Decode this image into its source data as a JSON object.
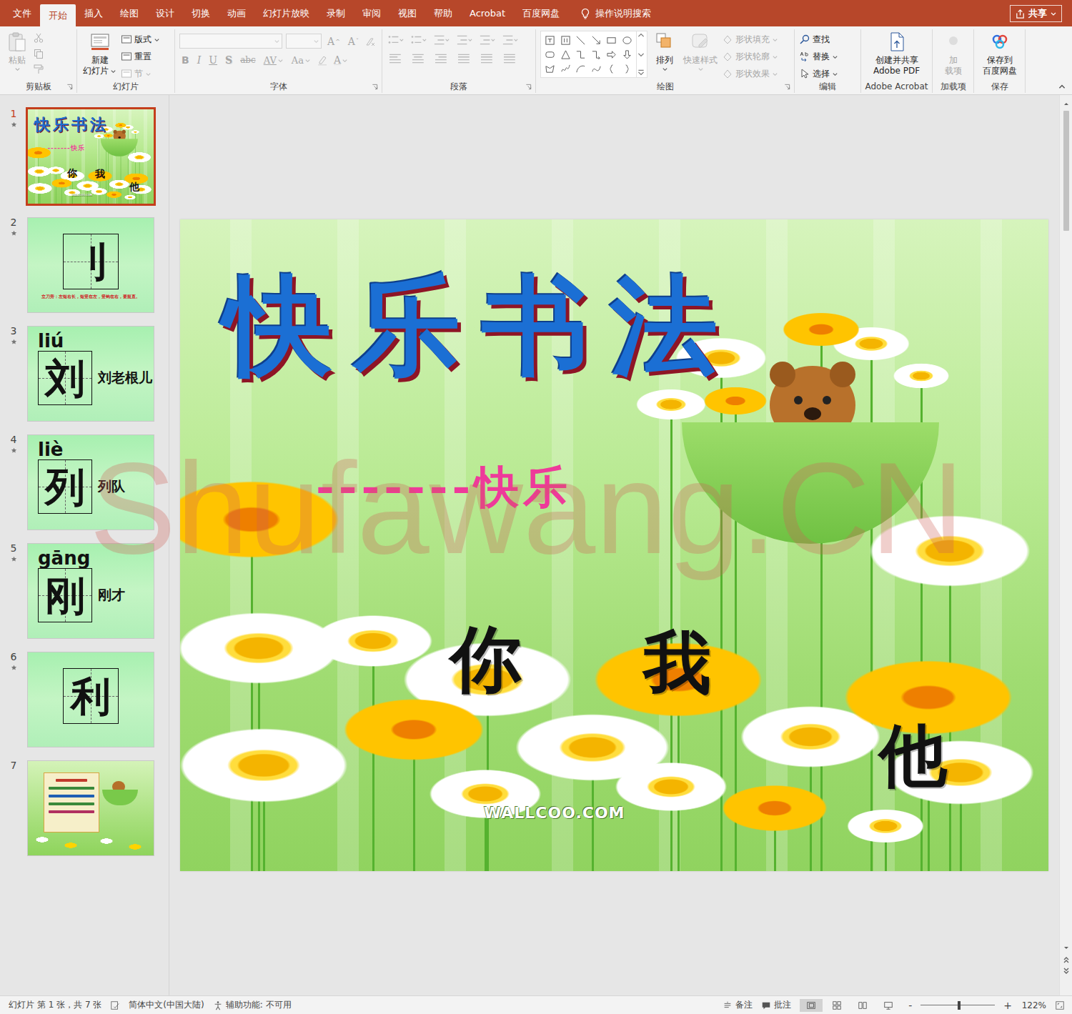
{
  "tabs": [
    {
      "label": "文件",
      "selected": false
    },
    {
      "label": "开始",
      "selected": true
    },
    {
      "label": "插入",
      "selected": false
    },
    {
      "label": "绘图",
      "selected": false
    },
    {
      "label": "设计",
      "selected": false
    },
    {
      "label": "切换",
      "selected": false
    },
    {
      "label": "动画",
      "selected": false
    },
    {
      "label": "幻灯片放映",
      "selected": false
    },
    {
      "label": "录制",
      "selected": false
    },
    {
      "label": "审阅",
      "selected": false
    },
    {
      "label": "视图",
      "selected": false
    },
    {
      "label": "帮助",
      "selected": false
    },
    {
      "label": "Acrobat",
      "selected": false
    },
    {
      "label": "百度网盘",
      "selected": false
    }
  ],
  "search": {
    "label": "操作说明搜索"
  },
  "share": {
    "label": "共享"
  },
  "ribbon": {
    "clipboard": {
      "label": "剪贴板",
      "paste": {
        "label": "粘贴",
        "disabled": true
      }
    },
    "slides": {
      "label": "幻灯片",
      "new_slide": {
        "line1": "新建",
        "line2": "幻灯片"
      },
      "items": [
        {
          "label": "版式",
          "disabled": false,
          "dropdown": true
        },
        {
          "label": "重置",
          "disabled": false,
          "dropdown": false
        },
        {
          "label": "节",
          "disabled": true,
          "dropdown": true
        }
      ]
    },
    "font": {
      "label": "字体",
      "font_name": "",
      "font_size": "",
      "grow": {
        "label": "A",
        "disabled": true
      },
      "shrink": {
        "label": "A",
        "disabled": true
      },
      "format_buttons": [
        {
          "label": "B",
          "kind": "bold",
          "disabled": true,
          "dropdown": false
        },
        {
          "label": "I",
          "kind": "italic",
          "disabled": true,
          "dropdown": false
        },
        {
          "label": "U",
          "kind": "underline",
          "disabled": true,
          "dropdown": false
        },
        {
          "label": "S",
          "kind": "shadow",
          "disabled": true,
          "dropdown": false
        },
        {
          "label": "abc",
          "kind": "strike",
          "disabled": true,
          "dropdown": false
        },
        {
          "label": "AV",
          "kind": "spacing",
          "disabled": true,
          "dropdown": true
        },
        {
          "label": "Aa",
          "kind": "case",
          "disabled": true,
          "dropdown": true
        }
      ],
      "color_button": {
        "label": "A",
        "disabled": true
      }
    },
    "paragraph": {
      "label": "段落",
      "disabled": true
    },
    "drawing": {
      "label": "绘图",
      "arrange": {
        "label": "排列",
        "disabled": false
      },
      "quick_styles": {
        "label": "快速样式",
        "disabled": true
      },
      "items": [
        {
          "label": "形状填充",
          "disabled": true
        },
        {
          "label": "形状轮廓",
          "disabled": true
        },
        {
          "label": "形状效果",
          "disabled": true
        }
      ]
    },
    "editing": {
      "label": "编辑",
      "items": [
        {
          "label": "查找",
          "kind": "find",
          "dropdown": false
        },
        {
          "label": "替换",
          "kind": "replace",
          "dropdown": true
        },
        {
          "label": "选择",
          "kind": "select",
          "dropdown": true
        }
      ]
    },
    "acrobat": {
      "label": "Adobe Acrobat",
      "line1": "创建并共享",
      "line2": "Adobe PDF"
    },
    "addins": {
      "label": "加载项",
      "line1": "加",
      "line2": "载项",
      "disabled": true
    },
    "save": {
      "label": "保存",
      "line1": "保存到",
      "line2": "百度网盘"
    }
  },
  "thumbnails": [
    {
      "number": "1",
      "animated": true,
      "selected": true,
      "kind": "title"
    },
    {
      "number": "2",
      "animated": true,
      "selected": false,
      "kind": "centered",
      "char": "刂",
      "note": "立刀旁：左短右长，短竖在左，竖钩在右，要挺直。"
    },
    {
      "number": "3",
      "animated": true,
      "selected": false,
      "kind": "pinyin",
      "pinyin": "liú",
      "char": "刘",
      "word": "刘老根儿"
    },
    {
      "number": "4",
      "animated": true,
      "selected": false,
      "kind": "pinyin",
      "pinyin": "liè",
      "char": "列",
      "word": "列队"
    },
    {
      "number": "5",
      "animated": true,
      "selected": false,
      "kind": "pinyin",
      "pinyin": "gāng",
      "char": "刚",
      "word": "刚才"
    },
    {
      "number": "6",
      "animated": true,
      "selected": false,
      "kind": "centered",
      "char": "利"
    },
    {
      "number": "7",
      "animated": false,
      "selected": false,
      "kind": "poem"
    }
  ],
  "slide": {
    "title": "快乐书法",
    "subtitle": "-------快乐",
    "words": [
      "你",
      "我",
      "他"
    ],
    "credit": "WALLCOO.COM",
    "watermark": "Shufawang.CN"
  },
  "status_bar": {
    "slide_info": "幻灯片 第 1 张，共 7 张",
    "language": "简体中文(中国大陆)",
    "accessibility": "辅助功能: 不可用",
    "notes": "备注",
    "comments": "批注",
    "views": [
      {
        "name": "normal",
        "selected": true
      },
      {
        "name": "sorter",
        "selected": false
      },
      {
        "name": "reading",
        "selected": false
      },
      {
        "name": "slideshow",
        "selected": false
      }
    ],
    "zoom": {
      "minus": "-",
      "plus": "+",
      "level": 0.52,
      "reading": "122%"
    }
  }
}
